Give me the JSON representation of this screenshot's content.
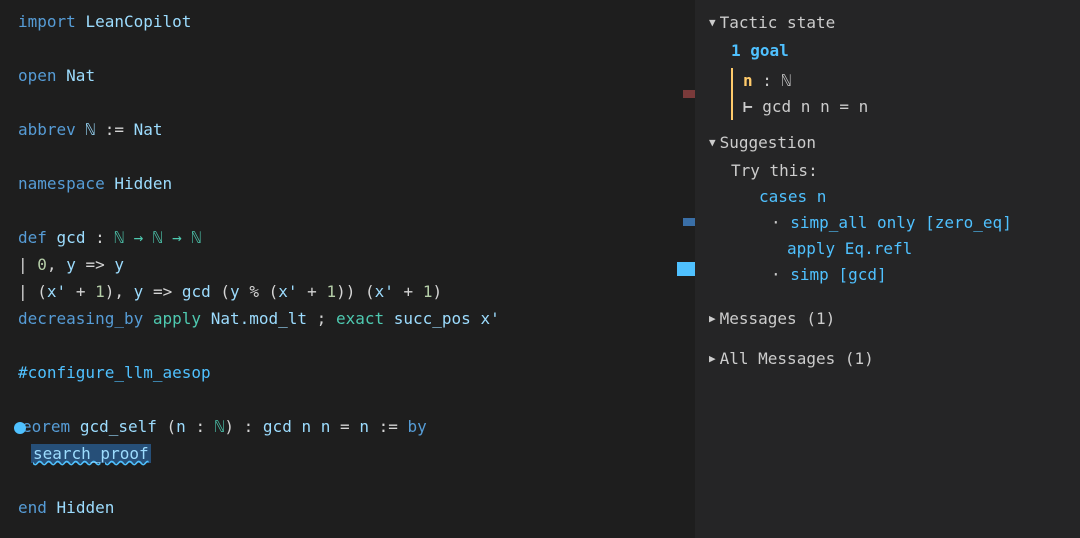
{
  "editor": {
    "line1": {
      "kw": "import",
      "mod": "LeanCopilot"
    },
    "line3": {
      "kw": "open",
      "ns": "Nat"
    },
    "line5": {
      "kw": "abbrev",
      "name": "ℕ",
      "coloneq": ":=",
      "rhs": "Nat"
    },
    "line7": {
      "kw": "namespace",
      "ns": "Hidden"
    },
    "line9": {
      "kw": "def",
      "name": "gcd",
      "colon": ":",
      "sig": "ℕ → ℕ → ℕ"
    },
    "line10": {
      "bar": "|",
      "zero": "0",
      "comma": ",",
      "y": "y",
      "arrow": "=>",
      "rhs": "y"
    },
    "line11": {
      "bar": "|",
      "lpar": "(",
      "xp": "x'",
      "plus": "+",
      "one": "1",
      "rpar": ")",
      "comma": ",",
      "y": "y",
      "arrow": "=>",
      "gcd": "gcd",
      "l2": "(",
      "y2": "y",
      "mod": "%",
      "l3": "(",
      "xp2": "x'",
      "plus2": "+",
      "one2": "1",
      "r3": ")",
      "r2": ")",
      "l4": "(",
      "xp3": "x'",
      "plus3": "+",
      "one3": "1",
      "r4": ")"
    },
    "line12": {
      "kw": "decreasing_by",
      "apply": "apply",
      "lemma": "Nat.mod_lt",
      "semi": ";",
      "exact": "exact",
      "succ": "succ_pos",
      "xp": "x'"
    },
    "line14": {
      "hash": "#configure_llm_aesop"
    },
    "line16": {
      "kw": "eorem",
      "name": "gcd_self",
      "lpar": "(",
      "n": "n",
      "colon": ":",
      "type": "ℕ",
      "rpar": ")",
      "colon2": ":",
      "gcd": "gcd",
      "n1": "n",
      "n2": "n",
      "eq": "=",
      "n3": "n",
      "coloneq": ":=",
      "by": "by"
    },
    "line17": {
      "tactic": "search_proof"
    },
    "line19": {
      "kw": "end",
      "ns": "Hidden"
    }
  },
  "panel": {
    "tactic_header": "Tactic state",
    "goal_count": "1",
    "goal_word": "goal",
    "goal_ctx_var": "n",
    "goal_ctx_colon": " : ",
    "goal_ctx_type": "ℕ",
    "goal_turnstile": "⊢",
    "goal_expr": " gcd n n = n",
    "suggestion_header": "Suggestion",
    "trythis": "Try this:",
    "sugg1": "cases n",
    "sugg2a": "simp_all only [zero_eq]",
    "sugg2b": "apply Eq.refl",
    "sugg3": "simp [gcd]",
    "messages_header": "Messages (1)",
    "all_messages_header": "All Messages (1)"
  }
}
